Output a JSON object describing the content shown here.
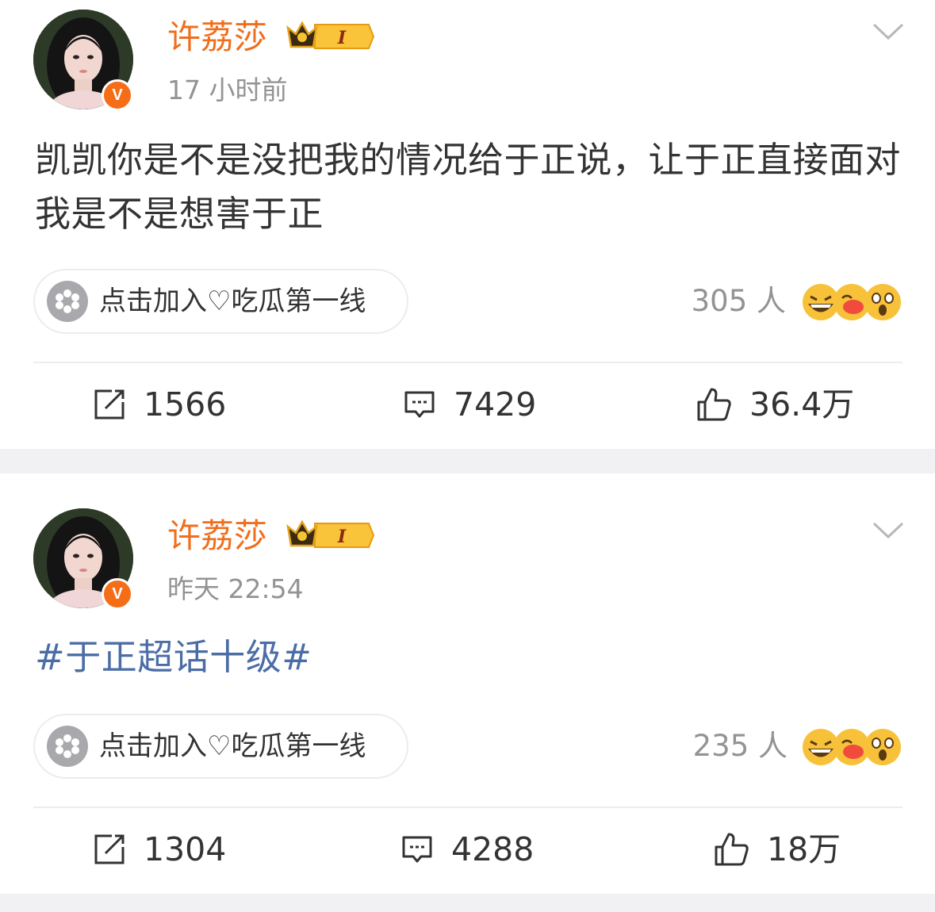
{
  "posts": [
    {
      "author": "许荔莎",
      "level_badge": "I",
      "time": "17 小时前",
      "content": "凯凯你是不是没把我的情况给于正说，让于正直接面对我是不是想害于正",
      "group_button": "点击加入♡吃瓜第一线",
      "reaction_count": "305 人",
      "reaction_icons": [
        "laughing-emoji-icon",
        "kissing-emoji-icon",
        "shocked-emoji-icon"
      ],
      "reposts": "1566",
      "comments": "7429",
      "likes": "36.4万"
    },
    {
      "author": "许荔莎",
      "level_badge": "I",
      "time": "昨天 22:54",
      "content": "#于正超话十级#",
      "group_button": "点击加入♡吃瓜第一线",
      "reaction_count": "235 人",
      "reaction_icons": [
        "laughing-emoji-icon",
        "kissing-emoji-icon",
        "shocked-emoji-icon"
      ],
      "reposts": "1304",
      "comments": "4288",
      "likes": "18万"
    }
  ],
  "colors": {
    "author_name": "#f06e1c",
    "verified_badge": "#f56e17",
    "topic_link": "#4b6da6",
    "secondary_text": "#939393",
    "page_background": "#f1f1f3"
  }
}
